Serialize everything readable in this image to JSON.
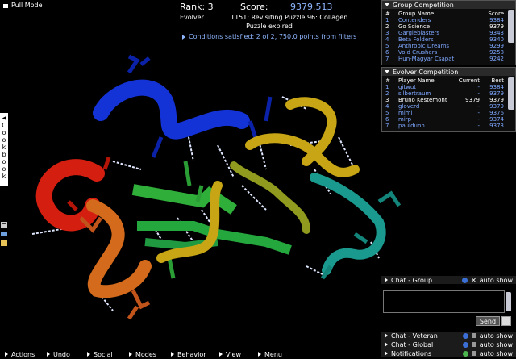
{
  "top_left": {
    "mode_label": "Pull Mode"
  },
  "score_panel": {
    "rank": "Rank: 3",
    "score_label": "Score:",
    "score_value": "9379.513",
    "role": "Evolver",
    "puzzle": "1151: Revisiting Puzzle 96: Collagen",
    "status": "Puzzle expired",
    "conditions": "Conditions satisfied: 2 of 2, 750.0 points from filters"
  },
  "group_competition": {
    "title": "Group Competition",
    "header": {
      "rank": "#",
      "name": "Group Name",
      "score": "Score"
    },
    "rows": [
      {
        "rank": "1",
        "name": "Contenders",
        "score": "9384",
        "selected": false
      },
      {
        "rank": "2",
        "name": "Go Science",
        "score": "9379",
        "selected": true
      },
      {
        "rank": "3",
        "name": "Gargleblasters",
        "score": "9343",
        "selected": false
      },
      {
        "rank": "4",
        "name": "Beta Folders",
        "score": "9340",
        "selected": false
      },
      {
        "rank": "5",
        "name": "Anthropic Dreams",
        "score": "9299",
        "selected": false
      },
      {
        "rank": "6",
        "name": "Void Crushers",
        "score": "9258",
        "selected": false
      },
      {
        "rank": "7",
        "name": "Hun-Magyar Csapat",
        "score": "9242",
        "selected": false
      }
    ]
  },
  "evolver_competition": {
    "title": "Evolver Competition",
    "header": {
      "rank": "#",
      "name": "Player Name",
      "current": "Current",
      "best": "Best"
    },
    "rows": [
      {
        "rank": "1",
        "name": "gitwut",
        "current": "-",
        "best": "9384",
        "selected": false
      },
      {
        "rank": "2",
        "name": "silbertraum",
        "current": "-",
        "best": "9379",
        "selected": false
      },
      {
        "rank": "3",
        "name": "Bruno Kestemont",
        "current": "9379",
        "best": "9379",
        "selected": true
      },
      {
        "rank": "4",
        "name": "gloverd",
        "current": "-",
        "best": "9379",
        "selected": false
      },
      {
        "rank": "5",
        "name": "mimi",
        "current": "-",
        "best": "9376",
        "selected": false
      },
      {
        "rank": "6",
        "name": "mirp",
        "current": "-",
        "best": "9374",
        "selected": false
      },
      {
        "rank": "7",
        "name": "pauldunn",
        "current": "-",
        "best": "9373",
        "selected": false
      }
    ]
  },
  "chat": {
    "group_label": "Chat - Group",
    "veteran_label": "Chat - Veteran",
    "global_label": "Chat - Global",
    "notifications_label": "Notifications",
    "auto_show": "auto show",
    "send_label": "Send",
    "input_value": ""
  },
  "cookbook": {
    "label": "Cookbook"
  },
  "bottom_menu": [
    "Actions",
    "Undo",
    "Social",
    "Modes",
    "Behavior",
    "View",
    "Menu"
  ],
  "colors": {
    "link": "#7ea7ff",
    "score": "#8fb6ff",
    "blue_chain": "#0a2fd0",
    "green_chain": "#2fae3a",
    "teal_chain": "#1a9a8e",
    "yellow_chain": "#c7a514",
    "orange_chain": "#d46a1c",
    "red_chain": "#d41e10"
  }
}
